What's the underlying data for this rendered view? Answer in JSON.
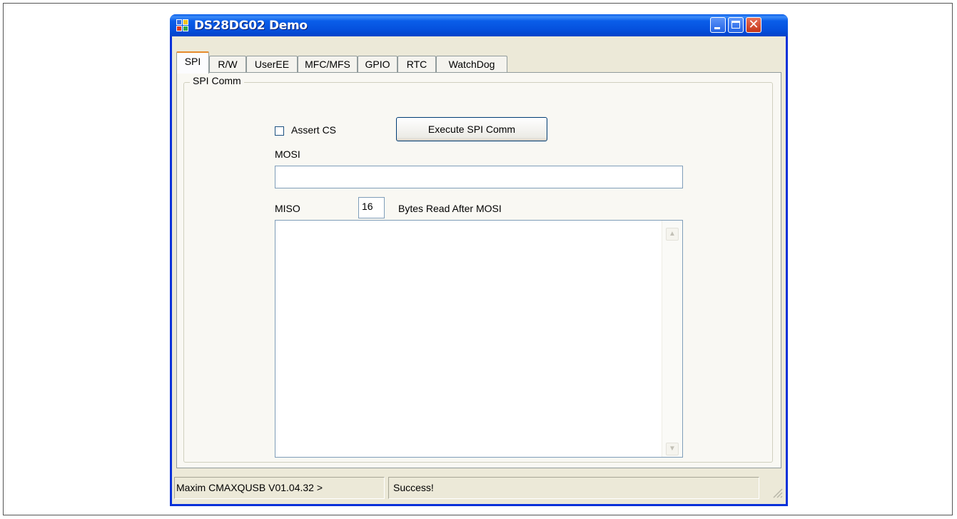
{
  "window": {
    "title": "DS28DG02 Demo"
  },
  "tabs": [
    {
      "label": "SPI",
      "active": true
    },
    {
      "label": "R/W",
      "active": false
    },
    {
      "label": "UserEE",
      "active": false
    },
    {
      "label": "MFC/MFS",
      "active": false
    },
    {
      "label": "GPIO",
      "active": false
    },
    {
      "label": "RTC",
      "active": false
    },
    {
      "label": "WatchDog",
      "active": false
    }
  ],
  "spi_comm": {
    "group_title": "SPI Comm",
    "assert_cs_label": "Assert CS",
    "assert_cs_checked": false,
    "execute_button_label": "Execute SPI Comm",
    "mosi_label": "MOSI",
    "mosi_value": "",
    "miso_label": "MISO",
    "bytes_value": "16",
    "bytes_label": "Bytes Read After MOSI",
    "miso_value": ""
  },
  "statusbar": {
    "device": "Maxim CMAXQUSB V01.04.32 >",
    "status": "Success!"
  },
  "colors": {
    "titlebar": "#0a5ee9",
    "window_bg": "#ece9d8",
    "close_button": "#c43517"
  },
  "icons": {
    "app": "app-window-icon",
    "minimize": "minimize-icon",
    "maximize": "maximize-icon",
    "close": "close-icon",
    "scroll_up": "chevron-up-icon",
    "scroll_down": "chevron-down-icon",
    "resize": "resize-grip-icon"
  }
}
